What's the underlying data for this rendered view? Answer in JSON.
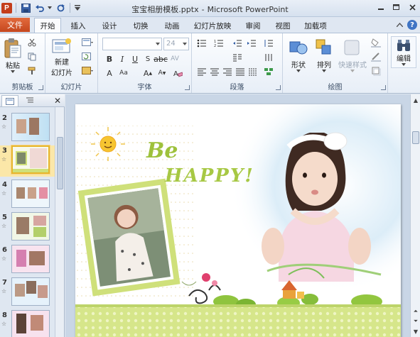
{
  "window": {
    "title_file": "宝宝相册模板.pptx",
    "title_sep": "-",
    "title_app": "Microsoft PowerPoint"
  },
  "quick_access": {
    "app_icon": "P"
  },
  "tabs": {
    "file": "文件",
    "items": [
      "开始",
      "插入",
      "设计",
      "切换",
      "动画",
      "幻灯片放映",
      "审阅",
      "视图",
      "加载项"
    ],
    "active": "开始"
  },
  "ribbon": {
    "clipboard": {
      "label": "剪贴板",
      "paste": "粘贴"
    },
    "slides": {
      "label": "幻灯片",
      "new_slide_line1": "新建",
      "new_slide_line2": "幻灯片"
    },
    "font": {
      "label": "字体",
      "font_name": "",
      "font_size": "24"
    },
    "paragraph": {
      "label": "段落"
    },
    "drawing": {
      "label": "绘图",
      "shapes": "形状",
      "arrange": "排列",
      "quick_styles": "快速样式"
    },
    "editing": {
      "label": "编辑"
    }
  },
  "slides_pane": {
    "thumbnails": [
      {
        "num": "2"
      },
      {
        "num": "3"
      },
      {
        "num": "4"
      },
      {
        "num": "5"
      },
      {
        "num": "6"
      },
      {
        "num": "7"
      },
      {
        "num": "8"
      }
    ],
    "selected": "3"
  },
  "slide": {
    "be_text": "Be",
    "happy_text": "HAPPY!"
  },
  "colors": {
    "file_tab": "#c5471e",
    "slide_green": "#cfe07a",
    "happy_green": "#9ec13b"
  }
}
